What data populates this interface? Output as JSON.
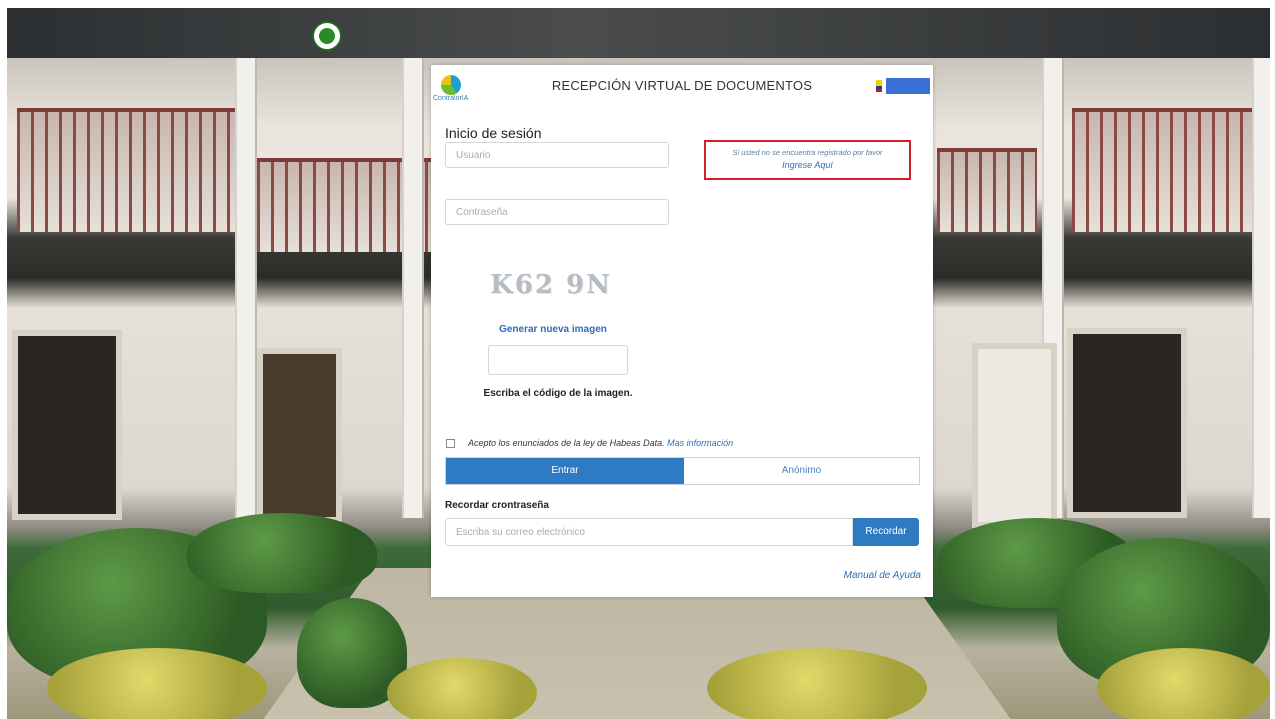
{
  "header": {
    "title": "RECEPCIÓN VIRTUAL DE DOCUMENTOS",
    "brand_text": "ContralorIA"
  },
  "login": {
    "heading": "Inicio de sesión",
    "user_placeholder": "Usuario",
    "password_placeholder": "Contraseña"
  },
  "notice": {
    "text": "Si usted no se encuentra registrado por favor",
    "link": "Ingrese Aquí"
  },
  "captcha": {
    "code": "K62 9N",
    "regenerate_label": "Generar nueva imagen",
    "instruction": "Escriba el código de la imagen."
  },
  "consent": {
    "text": "Acepto los enunciados de la ley de Habeas Data.",
    "link": "Mas información",
    "checked": false
  },
  "actions": {
    "enter_label": "Entrar",
    "anonymous_label": "Anónimo"
  },
  "recover": {
    "heading": "Recordar crontraseña",
    "email_placeholder": "Escriba su correo electrónico",
    "button_label": "Recordar"
  },
  "footer": {
    "help_link": "Manual de Ayuda"
  },
  "colors": {
    "primary": "#2f7bc3",
    "link": "#2f6db6",
    "notice_border": "#d0202a"
  }
}
